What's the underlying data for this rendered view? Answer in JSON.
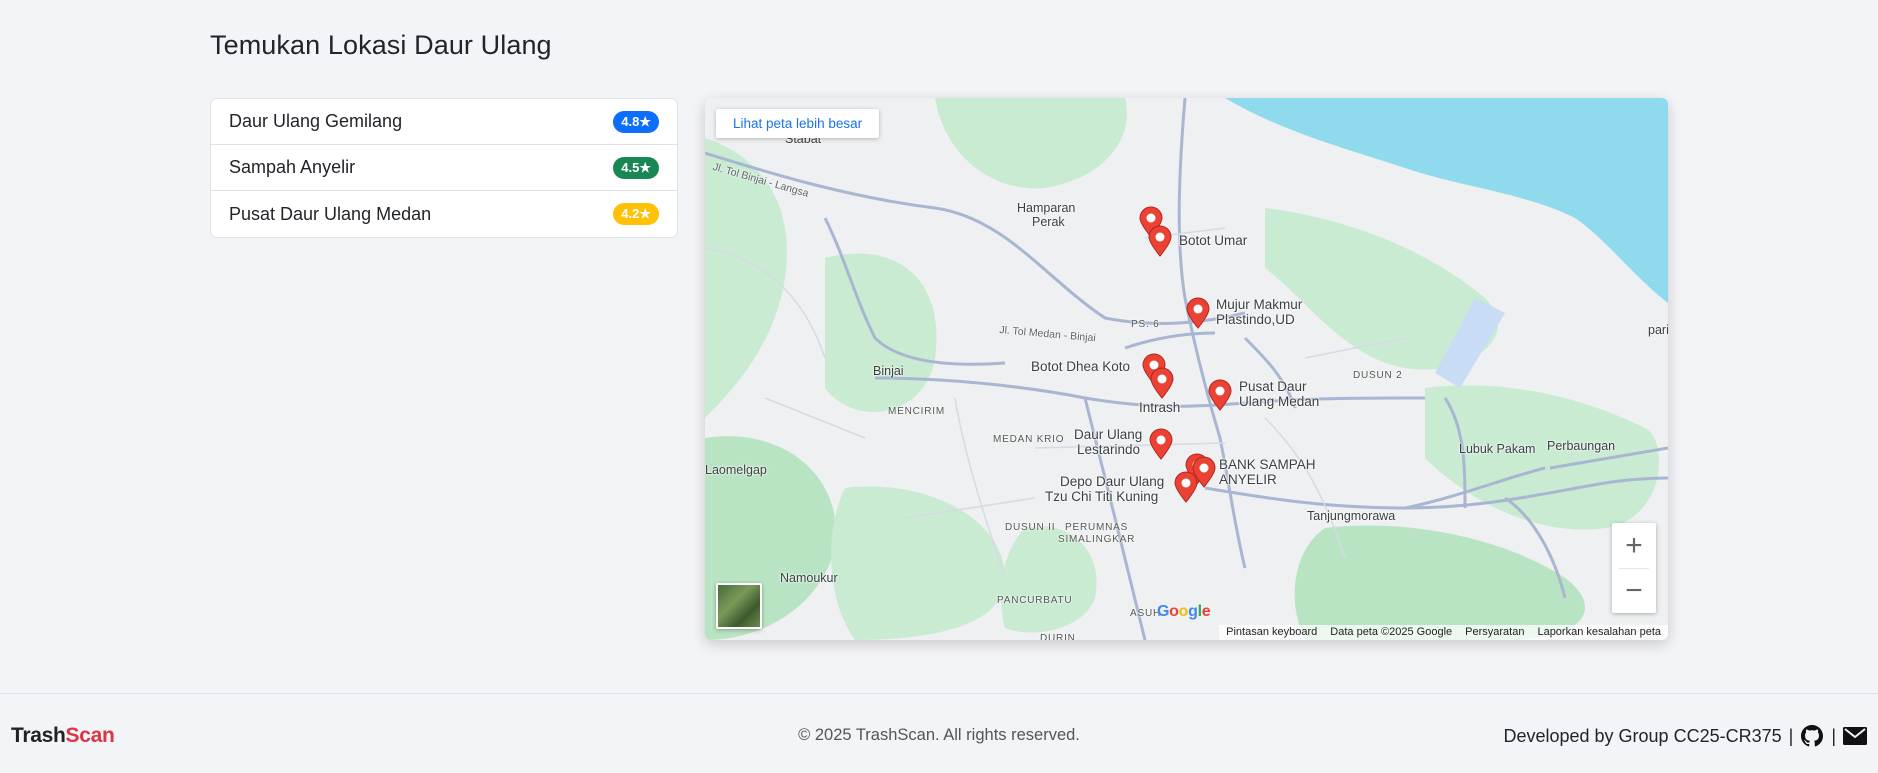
{
  "page": {
    "title": "Temukan Lokasi Daur Ulang"
  },
  "locations": [
    {
      "name": "Daur Ulang Gemilang",
      "rating": "4.8★",
      "badge_color": "#0d6efd"
    },
    {
      "name": "Sampah Anyelir",
      "rating": "4.5★",
      "badge_color": "#198754"
    },
    {
      "name": "Pusat Daur Ulang Medan",
      "rating": "4.2★",
      "badge_color": "#ffc107"
    }
  ],
  "map": {
    "view_larger_label": "Lihat peta lebih besar",
    "zoom_in": "+",
    "zoom_out": "−",
    "google_logo": "Google",
    "place_labels": {
      "bottom_umar": "Botot Umar",
      "mujur": "Mujur Makmur",
      "mujur2": "Plastindo,UD",
      "botot_dhea": "Botot Dhea Koto",
      "intrash": "Intrash",
      "pusat": "Pusat Daur",
      "pusat2": "Ulang Medan",
      "lestarindo": "Daur Ulang",
      "lestarindo2": "Lestarindo",
      "bank": "BANK SAMPAH",
      "bank2": "ANYELIR",
      "depo": "Depo Daur Ulang",
      "depo2": "Tzu Chi Titi Kuning"
    },
    "area_labels": {
      "stabat": "Stabat",
      "hamparan": "Hamparan",
      "hamparan2": "Perak",
      "binjai": "Binjai",
      "mencirim": "MENCIRIM",
      "medan_krio": "MEDAN KRIO",
      "laomelgap": "Laomelgap",
      "namoukur": "Namoukur",
      "dusun2": "DUSUN 2",
      "dusun_ii": "DUSUN II",
      "perumnas": "PERUMNAS",
      "simalingkar": "SIMALINGKAR",
      "pancurbatu": "PANCURBATU",
      "asuh": "ASUH",
      "lubuk": "Lubuk Pakam",
      "perbaungan": "Perbaungan",
      "tanjung": "Tanjungmorawa",
      "pari": "pari",
      "ps6": "PS. 6",
      "duri": "DURIN",
      "road1": "Jl. Tol Binjai - Langsa",
      "road2": "Jl. Tol Medan - Binjai"
    },
    "attribution": [
      "Pintasan keyboard",
      "Data peta ©2025 Google",
      "Persyaratan",
      "Laporkan kesalahan peta"
    ]
  },
  "footer": {
    "brand_part1": "Trash",
    "brand_part2": "Scan",
    "copyright": "© 2025 TrashScan. All rights reserved.",
    "credits": "Developed by Group CC25-CR375",
    "sep1": "|",
    "sep2": "|"
  }
}
